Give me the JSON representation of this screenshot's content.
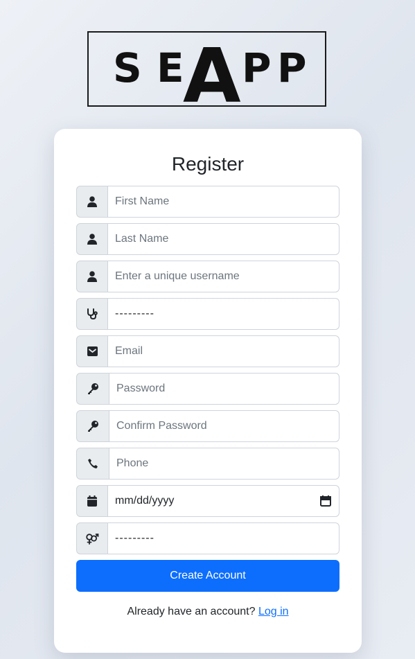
{
  "logo": {
    "text": "SEAPP",
    "letters": [
      "S",
      "E",
      "A",
      "P",
      "P"
    ]
  },
  "form": {
    "title": "Register",
    "first_name_placeholder": "First Name",
    "last_name_placeholder": "Last Name",
    "username_placeholder": "Enter a unique username",
    "specialty_value": "---------",
    "email_placeholder": "Email",
    "password_placeholder": "Password",
    "confirm_password_placeholder": "Confirm Password",
    "phone_placeholder": "Phone",
    "dob_value": "mm/dd/yyyy",
    "gender_value": "---------",
    "submit_label": "Create Account",
    "login_prompt": "Already have an account?",
    "login_link": "Log in"
  },
  "icons": {
    "first_name": "user-icon",
    "last_name": "user-icon",
    "username": "user-icon",
    "specialty": "stethoscope-icon",
    "email": "envelope-icon",
    "password": "key-icon",
    "confirm_password": "key-icon",
    "phone": "phone-icon",
    "dob": "calendar-icon",
    "gender": "venus-mars-icon"
  },
  "colors": {
    "primary": "#0d6efd",
    "addon_bg": "#e9ecef",
    "border": "#ced4da",
    "placeholder": "#6c757d"
  }
}
